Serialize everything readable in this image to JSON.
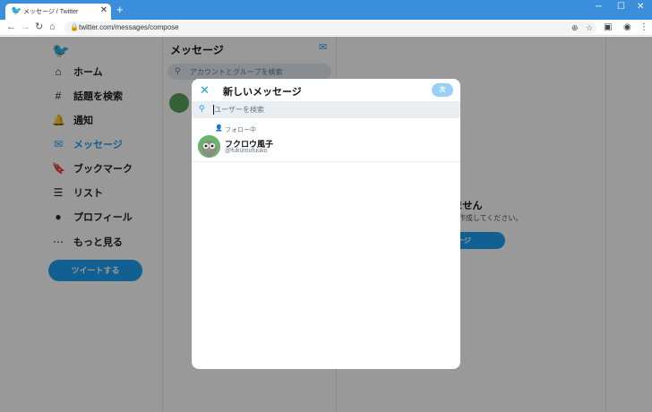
{
  "browser": {
    "tab_title": "メッセージ / Twitter",
    "tab_close": "✕",
    "new_tab": "+",
    "url": "twitter.com/messages/compose",
    "win_min": "─",
    "win_max": "☐",
    "win_close": "✕"
  },
  "sidebar": {
    "items": [
      {
        "icon": "⌂",
        "label": "ホーム"
      },
      {
        "icon": "#",
        "label": "話題を検索"
      },
      {
        "icon": "🔔",
        "label": "通知"
      },
      {
        "icon": "✉",
        "label": "メッセージ"
      },
      {
        "icon": "🔖",
        "label": "ブックマーク"
      },
      {
        "icon": "☰",
        "label": "リスト"
      },
      {
        "icon": "●",
        "label": "プロフィール"
      },
      {
        "icon": "⋯",
        "label": "もっと見る"
      }
    ],
    "tweet_button": "ツイートする"
  },
  "messages": {
    "title": "メッセージ",
    "search_placeholder": "アカウントとグループを検索"
  },
  "empty_state": {
    "title": "セージはありません",
    "subtitle": "新しいメッセージを作成してください。",
    "button": "いメッセージ"
  },
  "modal": {
    "title": "新しいメッセージ",
    "next_button": "次",
    "search_placeholder": "ユーザーを検索",
    "section_label": "フォロー中",
    "user": {
      "name": "フクロウ風子",
      "handle": "@fukuroufuuko"
    }
  },
  "colors": {
    "accent": "#1da1f2",
    "chrome": "#3a8edb"
  }
}
